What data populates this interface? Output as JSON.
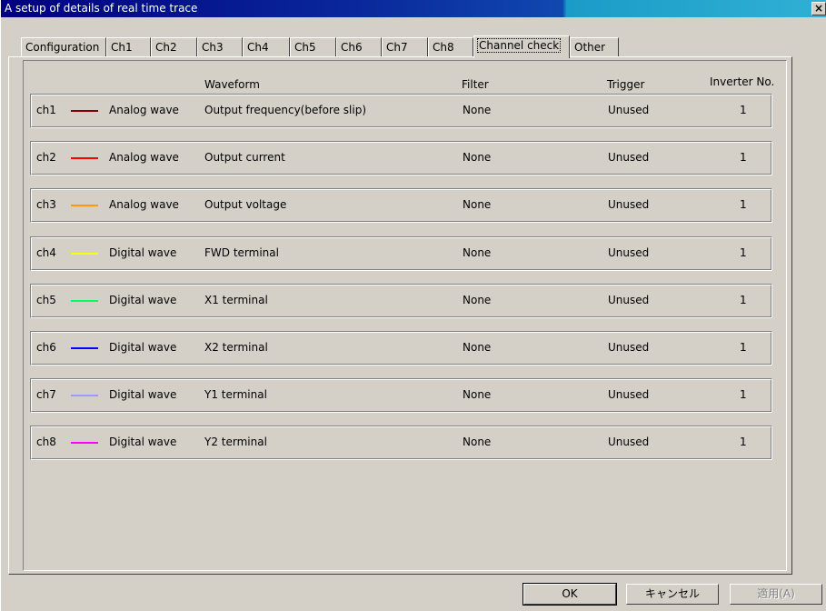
{
  "window": {
    "title": "A setup of details of real time trace",
    "close_label": "×"
  },
  "tabs": [
    "Configuration",
    "Ch1",
    "Ch2",
    "Ch3",
    "Ch4",
    "Ch5",
    "Ch6",
    "Ch7",
    "Ch8",
    "Channel check",
    "Other"
  ],
  "active_tab": "Channel check",
  "headers": {
    "waveform": "Waveform",
    "filter": "Filter",
    "trigger": "Trigger",
    "inverter": "Inverter No."
  },
  "channels": [
    {
      "ch": "ch1",
      "color": "#800000",
      "kind": "Analog wave",
      "waveform": "Output frequency(before slip)",
      "filter": "None",
      "trigger": "Unused",
      "inverter": "1"
    },
    {
      "ch": "ch2",
      "color": "#ff0000",
      "kind": "Analog wave",
      "waveform": "Output current",
      "filter": "None",
      "trigger": "Unused",
      "inverter": "1"
    },
    {
      "ch": "ch3",
      "color": "#ff9900",
      "kind": "Analog wave",
      "waveform": "Output voltage",
      "filter": "None",
      "trigger": "Unused",
      "inverter": "1"
    },
    {
      "ch": "ch4",
      "color": "#ffff00",
      "kind": "Digital wave",
      "waveform": "FWD terminal",
      "filter": "None",
      "trigger": "Unused",
      "inverter": "1"
    },
    {
      "ch": "ch5",
      "color": "#00ff66",
      "kind": "Digital wave",
      "waveform": "X1 terminal",
      "filter": "None",
      "trigger": "Unused",
      "inverter": "1"
    },
    {
      "ch": "ch6",
      "color": "#0000ff",
      "kind": "Digital wave",
      "waveform": "X2 terminal",
      "filter": "None",
      "trigger": "Unused",
      "inverter": "1"
    },
    {
      "ch": "ch7",
      "color": "#9999ff",
      "kind": "Digital wave",
      "waveform": "Y1 terminal",
      "filter": "None",
      "trigger": "Unused",
      "inverter": "1"
    },
    {
      "ch": "ch8",
      "color": "#ff00ff",
      "kind": "Digital wave",
      "waveform": "Y2 terminal",
      "filter": "None",
      "trigger": "Unused",
      "inverter": "1"
    }
  ],
  "buttons": {
    "ok": "OK",
    "cancel": "キャンセル",
    "apply": "適用(A)"
  }
}
